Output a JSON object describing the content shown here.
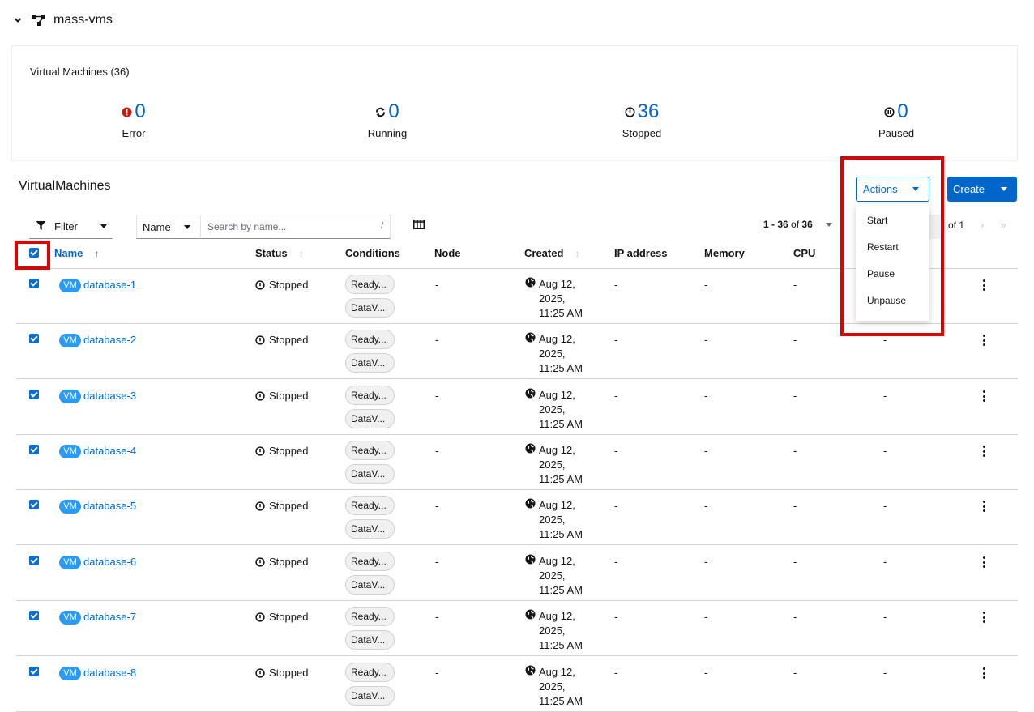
{
  "namespace": {
    "title": "mass-vms"
  },
  "summary": {
    "title": "Virtual Machines (36)",
    "stats": [
      {
        "label": "Error",
        "value": "0",
        "icon": "error-circle-icon",
        "color": "#c9190b"
      },
      {
        "label": "Running",
        "value": "0",
        "icon": "sync-icon",
        "color": "#151515"
      },
      {
        "label": "Stopped",
        "value": "36",
        "icon": "off-icon",
        "color": "#151515"
      },
      {
        "label": "Paused",
        "value": "0",
        "icon": "pause-circle-icon",
        "color": "#151515"
      }
    ]
  },
  "section_title": "VirtualMachines",
  "toolbar": {
    "actions_label": "Actions",
    "create_label": "Create",
    "filter_label": "Filter",
    "name_select": "Name",
    "search_placeholder": "Search by name...",
    "search_shortcut": "/"
  },
  "actions_menu": [
    "Start",
    "Restart",
    "Pause",
    "Unpause"
  ],
  "pagination": {
    "range": "1 - 36",
    "of": "of",
    "total": "36",
    "pages": "of 1"
  },
  "columns": {
    "name": "Name",
    "status": "Status",
    "conditions": "Conditions",
    "node": "Node",
    "created": "Created",
    "ip": "IP address",
    "memory": "Memory",
    "cpu": "CPU"
  },
  "rows": [
    {
      "badge": "VM",
      "name": "database-1",
      "status": "Stopped",
      "chips": [
        "Ready...",
        "DataV..."
      ],
      "node": "-",
      "created_line1": "Aug 12, 2025,",
      "created_line2": "11:25 AM",
      "ip": "-",
      "memory": "-",
      "cpu": "-",
      "extra": ""
    },
    {
      "badge": "VM",
      "name": "database-2",
      "status": "Stopped",
      "chips": [
        "Ready...",
        "DataV..."
      ],
      "node": "-",
      "created_line1": "Aug 12, 2025,",
      "created_line2": "11:25 AM",
      "ip": "-",
      "memory": "-",
      "cpu": "-",
      "extra": "-"
    },
    {
      "badge": "VM",
      "name": "database-3",
      "status": "Stopped",
      "chips": [
        "Ready...",
        "DataV..."
      ],
      "node": "-",
      "created_line1": "Aug 12, 2025,",
      "created_line2": "11:25 AM",
      "ip": "-",
      "memory": "-",
      "cpu": "-",
      "extra": "-"
    },
    {
      "badge": "VM",
      "name": "database-4",
      "status": "Stopped",
      "chips": [
        "Ready...",
        "DataV..."
      ],
      "node": "-",
      "created_line1": "Aug 12, 2025,",
      "created_line2": "11:25 AM",
      "ip": "-",
      "memory": "-",
      "cpu": "-",
      "extra": "-"
    },
    {
      "badge": "VM",
      "name": "database-5",
      "status": "Stopped",
      "chips": [
        "Ready...",
        "DataV..."
      ],
      "node": "-",
      "created_line1": "Aug 12, 2025,",
      "created_line2": "11:25 AM",
      "ip": "-",
      "memory": "-",
      "cpu": "-",
      "extra": "-"
    },
    {
      "badge": "VM",
      "name": "database-6",
      "status": "Stopped",
      "chips": [
        "Ready...",
        "DataV..."
      ],
      "node": "-",
      "created_line1": "Aug 12, 2025,",
      "created_line2": "11:25 AM",
      "ip": "-",
      "memory": "-",
      "cpu": "-",
      "extra": "-"
    },
    {
      "badge": "VM",
      "name": "database-7",
      "status": "Stopped",
      "chips": [
        "Ready...",
        "DataV..."
      ],
      "node": "-",
      "created_line1": "Aug 12, 2025,",
      "created_line2": "11:25 AM",
      "ip": "-",
      "memory": "-",
      "cpu": "-",
      "extra": "-"
    },
    {
      "badge": "VM",
      "name": "database-8",
      "status": "Stopped",
      "chips": [
        "Ready...",
        "DataV..."
      ],
      "node": "-",
      "created_line1": "Aug 12, 2025,",
      "created_line2": "11:25 AM",
      "ip": "-",
      "memory": "-",
      "cpu": "-",
      "extra": "-"
    }
  ]
}
